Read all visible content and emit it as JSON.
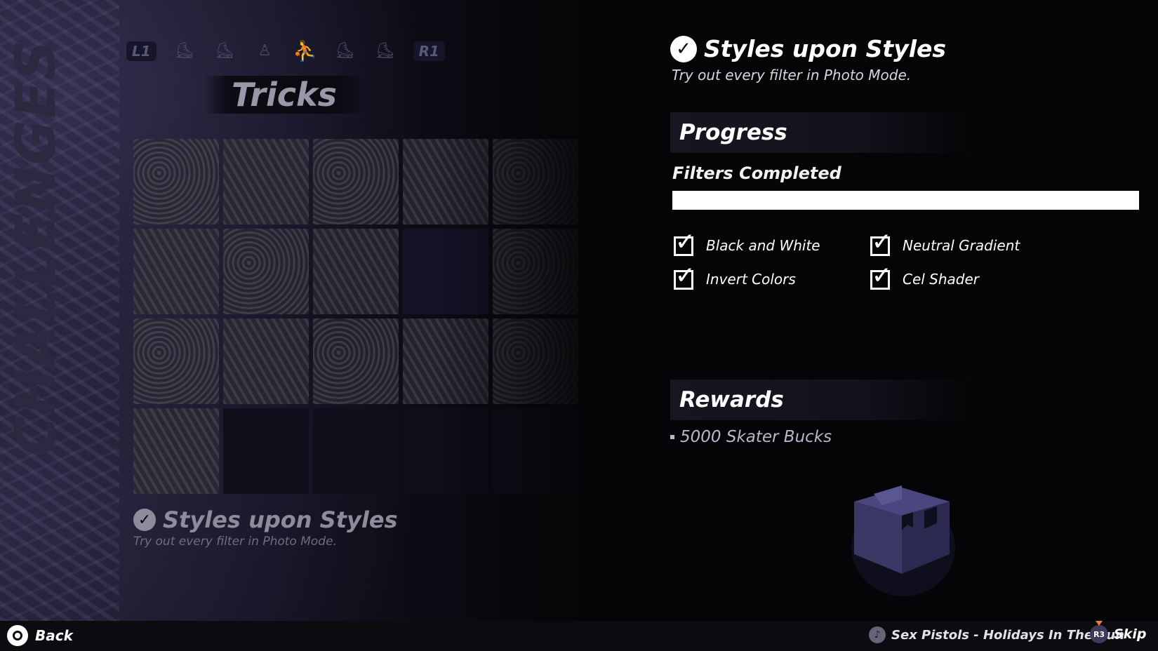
{
  "left": {
    "vertical_title": "CHALLENGES",
    "category_nav": {
      "prev_button": "L1",
      "next_button": "R1"
    },
    "section_title": "Tricks",
    "selected": {
      "title": "Styles upon Styles",
      "description": "Try out every filter in Photo Mode."
    }
  },
  "detail": {
    "title": "Styles upon Styles",
    "description": "Try out every filter in Photo Mode.",
    "progress": {
      "header": "Progress",
      "label": "Filters Completed",
      "fraction": 1.0,
      "filters": [
        {
          "label": "Black and White",
          "checked": true
        },
        {
          "label": "Neutral Gradient",
          "checked": true
        },
        {
          "label": "Invert Colors",
          "checked": true
        },
        {
          "label": "Cel Shader",
          "checked": true
        }
      ]
    },
    "rewards": {
      "header": "Rewards",
      "items": [
        "5000 Skater Bucks"
      ]
    }
  },
  "footer": {
    "back_label": "Back",
    "now_playing": "Sex Pistols - Holidays In The Sun",
    "skip_label": "Skip",
    "skip_button": "R3"
  },
  "colors": {
    "background": "#050507",
    "text": "#ffffff",
    "progress_fill": "#ffffff",
    "reward_text": "#b7b8c8",
    "reward_box": "#3b3866"
  },
  "icons": {
    "category_icons": [
      "skateboard-icon",
      "skateboard-grab-icon",
      "skater-icon",
      "trick-icon-active",
      "skateboard-flip-icon",
      "skateboard-grind-icon"
    ],
    "reward_icon": "crate-box-icon"
  }
}
